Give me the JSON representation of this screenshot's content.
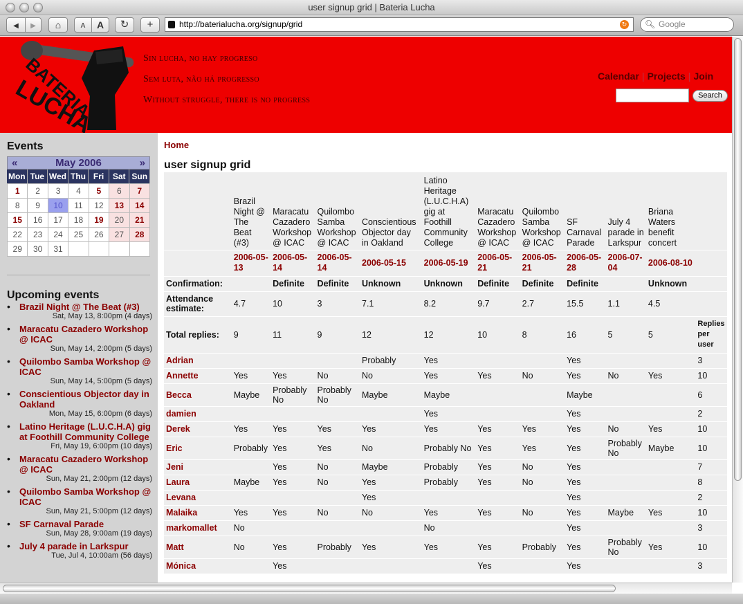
{
  "window": {
    "title": "user signup grid | Bateria Lucha"
  },
  "toolbar": {
    "font_small": "A",
    "font_large": "A",
    "reload": "↻",
    "add": "+",
    "back": "◀",
    "forward": "▶",
    "home": "⌂"
  },
  "url": "http://baterialucha.org/signup/grid",
  "google_placeholder": "Google",
  "header": {
    "logo_text": "BATERIA LUCHA",
    "mottos": [
      "Sin lucha, no hay progreso",
      "Sem luta, não há progresso",
      "Without struggle, there is no progress"
    ],
    "nav": [
      "Calendar",
      "Projects",
      "Join"
    ],
    "search_button": "Search"
  },
  "sidebar": {
    "events_heading": "Events",
    "calendar": {
      "month": "May 2006",
      "prev": "«",
      "next": "»",
      "days": [
        "Mon",
        "Tue",
        "Wed",
        "Thu",
        "Fri",
        "Sat",
        "Sun"
      ],
      "weeks": [
        [
          "1",
          "2",
          "3",
          "4",
          "5",
          "6",
          "7"
        ],
        [
          "8",
          "9",
          "10",
          "11",
          "12",
          "13",
          "14"
        ],
        [
          "15",
          "16",
          "17",
          "18",
          "19",
          "20",
          "21"
        ],
        [
          "22",
          "23",
          "24",
          "25",
          "26",
          "27",
          "28"
        ],
        [
          "29",
          "30",
          "31",
          "",
          "",
          "",
          ""
        ]
      ]
    },
    "upcoming_heading": "Upcoming events",
    "upcoming": [
      {
        "title": "Brazil Night @ The Beat (#3)",
        "date": "Sat, May 13, 8:00pm (4 days)"
      },
      {
        "title": "Maracatu Cazadero Workshop @ ICAC",
        "date": "Sun, May 14, 2:00pm (5 days)"
      },
      {
        "title": "Quilombo Samba Workshop @ ICAC",
        "date": "Sun, May 14, 5:00pm (5 days)"
      },
      {
        "title": "Conscientious Objector day in Oakland",
        "date": "Mon, May 15, 6:00pm (6 days)"
      },
      {
        "title": "Latino Heritage (L.U.C.H.A) gig at Foothill Community College",
        "date": "Fri, May 19, 6:00pm (10 days)"
      },
      {
        "title": "Maracatu Cazadero Workshop @ ICAC",
        "date": "Sun, May 21, 2:00pm (12 days)"
      },
      {
        "title": "Quilombo Samba Workshop @ ICAC",
        "date": "Sun, May 21, 5:00pm (12 days)"
      },
      {
        "title": "SF Carnaval Parade",
        "date": "Sun, May 28, 9:00am (19 days)"
      },
      {
        "title": "July 4 parade in Larkspur",
        "date": "Tue, Jul 4, 10:00am (56 days)"
      }
    ]
  },
  "main": {
    "breadcrumb": "Home",
    "title": "user signup grid",
    "events": [
      {
        "name": "Brazil Night @ The Beat (#3)",
        "date": "2006-05-13",
        "confirmation": "",
        "estimate": "4.7",
        "total": "9"
      },
      {
        "name": "Maracatu Cazadero Workshop @ ICAC",
        "date": "2006-05-14",
        "confirmation": "Definite",
        "estimate": "10",
        "total": "11"
      },
      {
        "name": "Quilombo Samba Workshop @ ICAC",
        "date": "2006-05-14",
        "confirmation": "Definite",
        "estimate": "3",
        "total": "9"
      },
      {
        "name": "Conscientious Objector day in Oakland",
        "date": "2006-05-15",
        "confirmation": "Unknown",
        "estimate": "7.1",
        "total": "12"
      },
      {
        "name": "Latino Heritage (L.U.C.H.A) gig at Foothill Community College",
        "date": "2006-05-19",
        "confirmation": "Unknown",
        "estimate": "8.2",
        "total": "12"
      },
      {
        "name": "Maracatu Cazadero Workshop @ ICAC",
        "date": "2006-05-21",
        "confirmation": "Definite",
        "estimate": "9.7",
        "total": "10"
      },
      {
        "name": "Quilombo Samba Workshop @ ICAC",
        "date": "2006-05-21",
        "confirmation": "Definite",
        "estimate": "2.7",
        "total": "8"
      },
      {
        "name": "SF Carnaval Parade",
        "date": "2006-05-28",
        "confirmation": "Definite",
        "estimate": "15.5",
        "total": "16"
      },
      {
        "name": "July 4 parade in Larkspur",
        "date": "2006-07-04",
        "confirmation": "",
        "estimate": "1.1",
        "total": "5"
      },
      {
        "name": "Briana Waters benefit concert",
        "date": "2006-08-10",
        "confirmation": "Unknown",
        "estimate": "4.5",
        "total": "5"
      }
    ],
    "row_labels": {
      "confirmation": "Confirmation:",
      "estimate": "Attendance estimate:",
      "total": "Total replies:",
      "replies_per_user": "Replies per user"
    },
    "users": [
      {
        "name": "Adrian",
        "replies": [
          "",
          "",
          "",
          "Probably",
          "Yes",
          "",
          "",
          "Yes",
          "",
          ""
        ],
        "count": "3"
      },
      {
        "name": "Annette",
        "replies": [
          "Yes",
          "Yes",
          "No",
          "No",
          "Yes",
          "Yes",
          "No",
          "Yes",
          "No",
          "Yes"
        ],
        "count": "10"
      },
      {
        "name": "Becca",
        "replies": [
          "Maybe",
          "Probably No",
          "Probably No",
          "Maybe",
          "Maybe",
          "",
          "",
          "Maybe",
          "",
          ""
        ],
        "count": "6"
      },
      {
        "name": "damien",
        "replies": [
          "",
          "",
          "",
          "",
          "Yes",
          "",
          "",
          "Yes",
          "",
          ""
        ],
        "count": "2"
      },
      {
        "name": "Derek",
        "replies": [
          "Yes",
          "Yes",
          "Yes",
          "Yes",
          "Yes",
          "Yes",
          "Yes",
          "Yes",
          "No",
          "Yes"
        ],
        "count": "10"
      },
      {
        "name": "Eric",
        "replies": [
          "Probably",
          "Yes",
          "Yes",
          "No",
          "Probably No",
          "Yes",
          "Yes",
          "Yes",
          "Probably No",
          "Maybe"
        ],
        "count": "10"
      },
      {
        "name": "Jeni",
        "replies": [
          "",
          "Yes",
          "No",
          "Maybe",
          "Probably",
          "Yes",
          "No",
          "Yes",
          "",
          ""
        ],
        "count": "7"
      },
      {
        "name": "Laura",
        "replies": [
          "Maybe",
          "Yes",
          "No",
          "Yes",
          "Probably",
          "Yes",
          "No",
          "Yes",
          "",
          ""
        ],
        "count": "8"
      },
      {
        "name": "Levana",
        "replies": [
          "",
          "",
          "",
          "Yes",
          "",
          "",
          "",
          "Yes",
          "",
          ""
        ],
        "count": "2"
      },
      {
        "name": "Malaika",
        "replies": [
          "Yes",
          "Yes",
          "No",
          "No",
          "Yes",
          "Yes",
          "No",
          "Yes",
          "Maybe",
          "Yes"
        ],
        "count": "10"
      },
      {
        "name": "markomallet",
        "replies": [
          "No",
          "",
          "",
          "",
          "No",
          "",
          "",
          "Yes",
          "",
          ""
        ],
        "count": "3"
      },
      {
        "name": "Matt",
        "replies": [
          "No",
          "Yes",
          "Probably",
          "Yes",
          "Yes",
          "Yes",
          "Probably",
          "Yes",
          "Probably No",
          "Yes"
        ],
        "count": "10"
      },
      {
        "name": "Mónica",
        "replies": [
          "",
          "Yes",
          "",
          "",
          "",
          "Yes",
          "",
          "Yes",
          "",
          ""
        ],
        "count": "3"
      }
    ]
  }
}
